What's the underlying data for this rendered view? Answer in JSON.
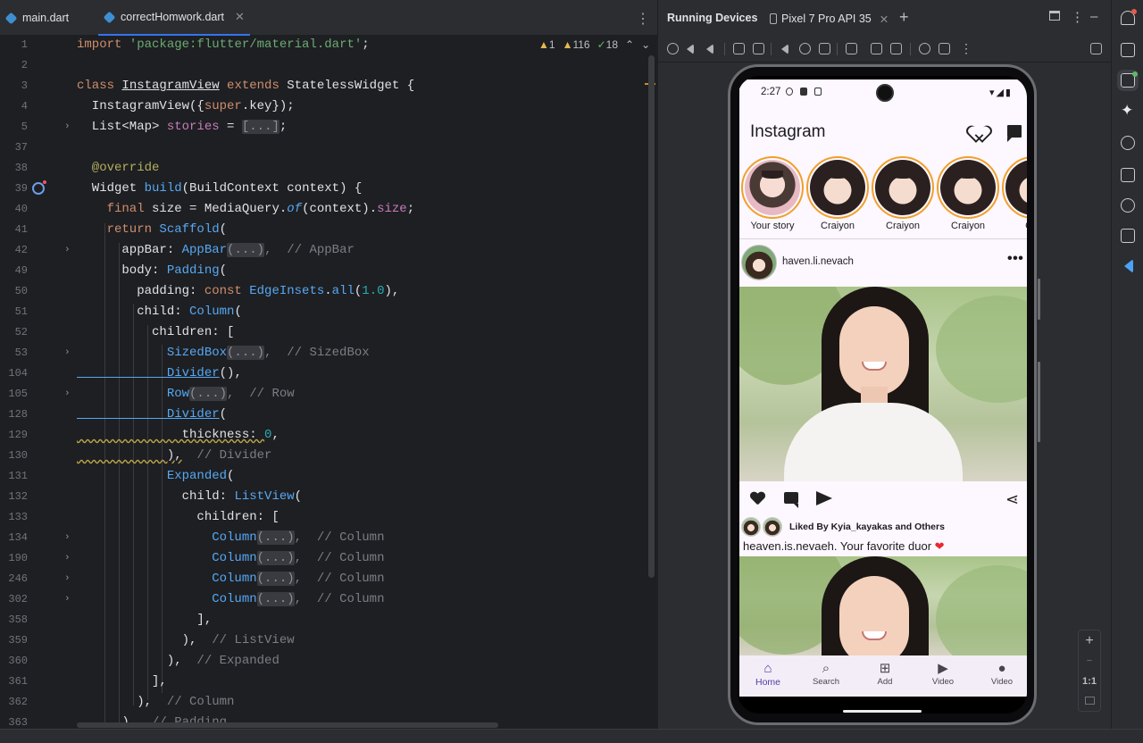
{
  "editor": {
    "tabs": [
      {
        "label": "main.dart",
        "active": false
      },
      {
        "label": "correctHomwork.dart",
        "active": true
      }
    ],
    "inspections": {
      "warnings": "1",
      "weak_warnings": "116",
      "typos": "18"
    },
    "line_numbers": [
      "1",
      "2",
      "3",
      "4",
      "5",
      "37",
      "38",
      "39",
      "40",
      "41",
      "42",
      "49",
      "50",
      "51",
      "52",
      "53",
      "104",
      "105",
      "128",
      "129",
      "130",
      "131",
      "132",
      "133",
      "134",
      "190",
      "246",
      "302",
      "358",
      "359",
      "360",
      "361",
      "362",
      "363"
    ],
    "code": {
      "l1_import": "import",
      "l1_str": "'package:flutter/material.dart'",
      "l3_class": "class",
      "l3_name": "InstagramView",
      "l3_extends": "extends",
      "l3_base": "StatelessWidget {",
      "l4": "  InstagramView({",
      "l4_super": "super",
      "l4_tail": ".key});",
      "l5_head": "  List<Map> ",
      "l5_var": "stories",
      "l5_eq": " = ",
      "l5_fold": "[...]",
      "l5_tail": ";",
      "l38": "  @override",
      "l39_a": "  Widget ",
      "l39_b": "build",
      "l39_c": "(BuildContext context) {",
      "l40_final": "    final",
      "l40_a": " size = MediaQuery.",
      "l40_of": "of",
      "l40_b": "(context).",
      "l40_size": "size",
      "l40_c": ";",
      "l41_ret": "    return",
      "l41_sc": " Scaffold",
      "l41_p": "(",
      "l42_a": "      appBar: ",
      "l42_cls": "AppBar",
      "l42_fold": "(...)",
      "l42_c": ",  // AppBar",
      "l49_a": "      body: ",
      "l49_cls": "Padding",
      "l49_p": "(",
      "l50_a": "        padding: ",
      "l50_const": "const",
      "l50_cls": " EdgeInsets",
      "l50_b": ".",
      "l50_all": "all",
      "l50_c": "(",
      "l50_num": "1.0",
      "l50_d": "),",
      "l51_a": "        child: ",
      "l51_cls": "Column",
      "l51_p": "(",
      "l52": "          children: [",
      "l53_cls": "            SizedBox",
      "l53_fold": "(...)",
      "l53_c": ",  // SizedBox",
      "l104_cls": "            Divider",
      "l104_t": "(),",
      "l105_cls": "            Row",
      "l105_fold": "(...)",
      "l105_c": ",  // Row",
      "l128_cls": "            Divider",
      "l128_p": "(",
      "l129_a": "              thickness: ",
      "l129_num": "0",
      "l129_b": ",",
      "l130_a": "            ),",
      "l130_c": "  // Divider",
      "l131_cls": "            Expanded",
      "l131_p": "(",
      "l132_a": "              child: ",
      "l132_cls": "ListView",
      "l132_p": "(",
      "l133": "                children: [",
      "col_cls": "                  Column",
      "col_fold": "(...)",
      "col_c": ",  // Column",
      "l358": "                ],",
      "l359_a": "              ),",
      "l359_c": "  // ListView",
      "l360_a": "            ),",
      "l360_c": "  // Expanded",
      "l361": "          ],",
      "l362_a": "        ),",
      "l362_c": "  // Column",
      "l363_a": "      ),",
      "l363_c": "  // Padding"
    }
  },
  "running_devices": {
    "title": "Running Devices",
    "device_tab": "Pixel 7 Pro API 35",
    "zoom": {
      "plus": "+",
      "minus": "−",
      "ratio": "1:1"
    }
  },
  "phone": {
    "status_time": "2:27",
    "app_title": "Instagram",
    "stories": [
      {
        "label": "Your story"
      },
      {
        "label": "Craiyon"
      },
      {
        "label": "Craiyon"
      },
      {
        "label": "Craiyon"
      },
      {
        "label": "Cra"
      }
    ],
    "post_username": "haven.li.nevach",
    "more": "•••",
    "likes_text": "Liked By Kyia_kayakas and Others",
    "caption_text": "heaven.is.nevaeh. Your favorite duor",
    "caption_emoji": "❤",
    "nav": [
      {
        "label": "Home",
        "icon": "home-icon"
      },
      {
        "label": "Search",
        "icon": "search-icon"
      },
      {
        "label": "Add",
        "icon": "add-box-icon"
      },
      {
        "label": "Video",
        "icon": "video-library-icon"
      },
      {
        "label": "Video",
        "icon": "person-icon"
      }
    ]
  }
}
